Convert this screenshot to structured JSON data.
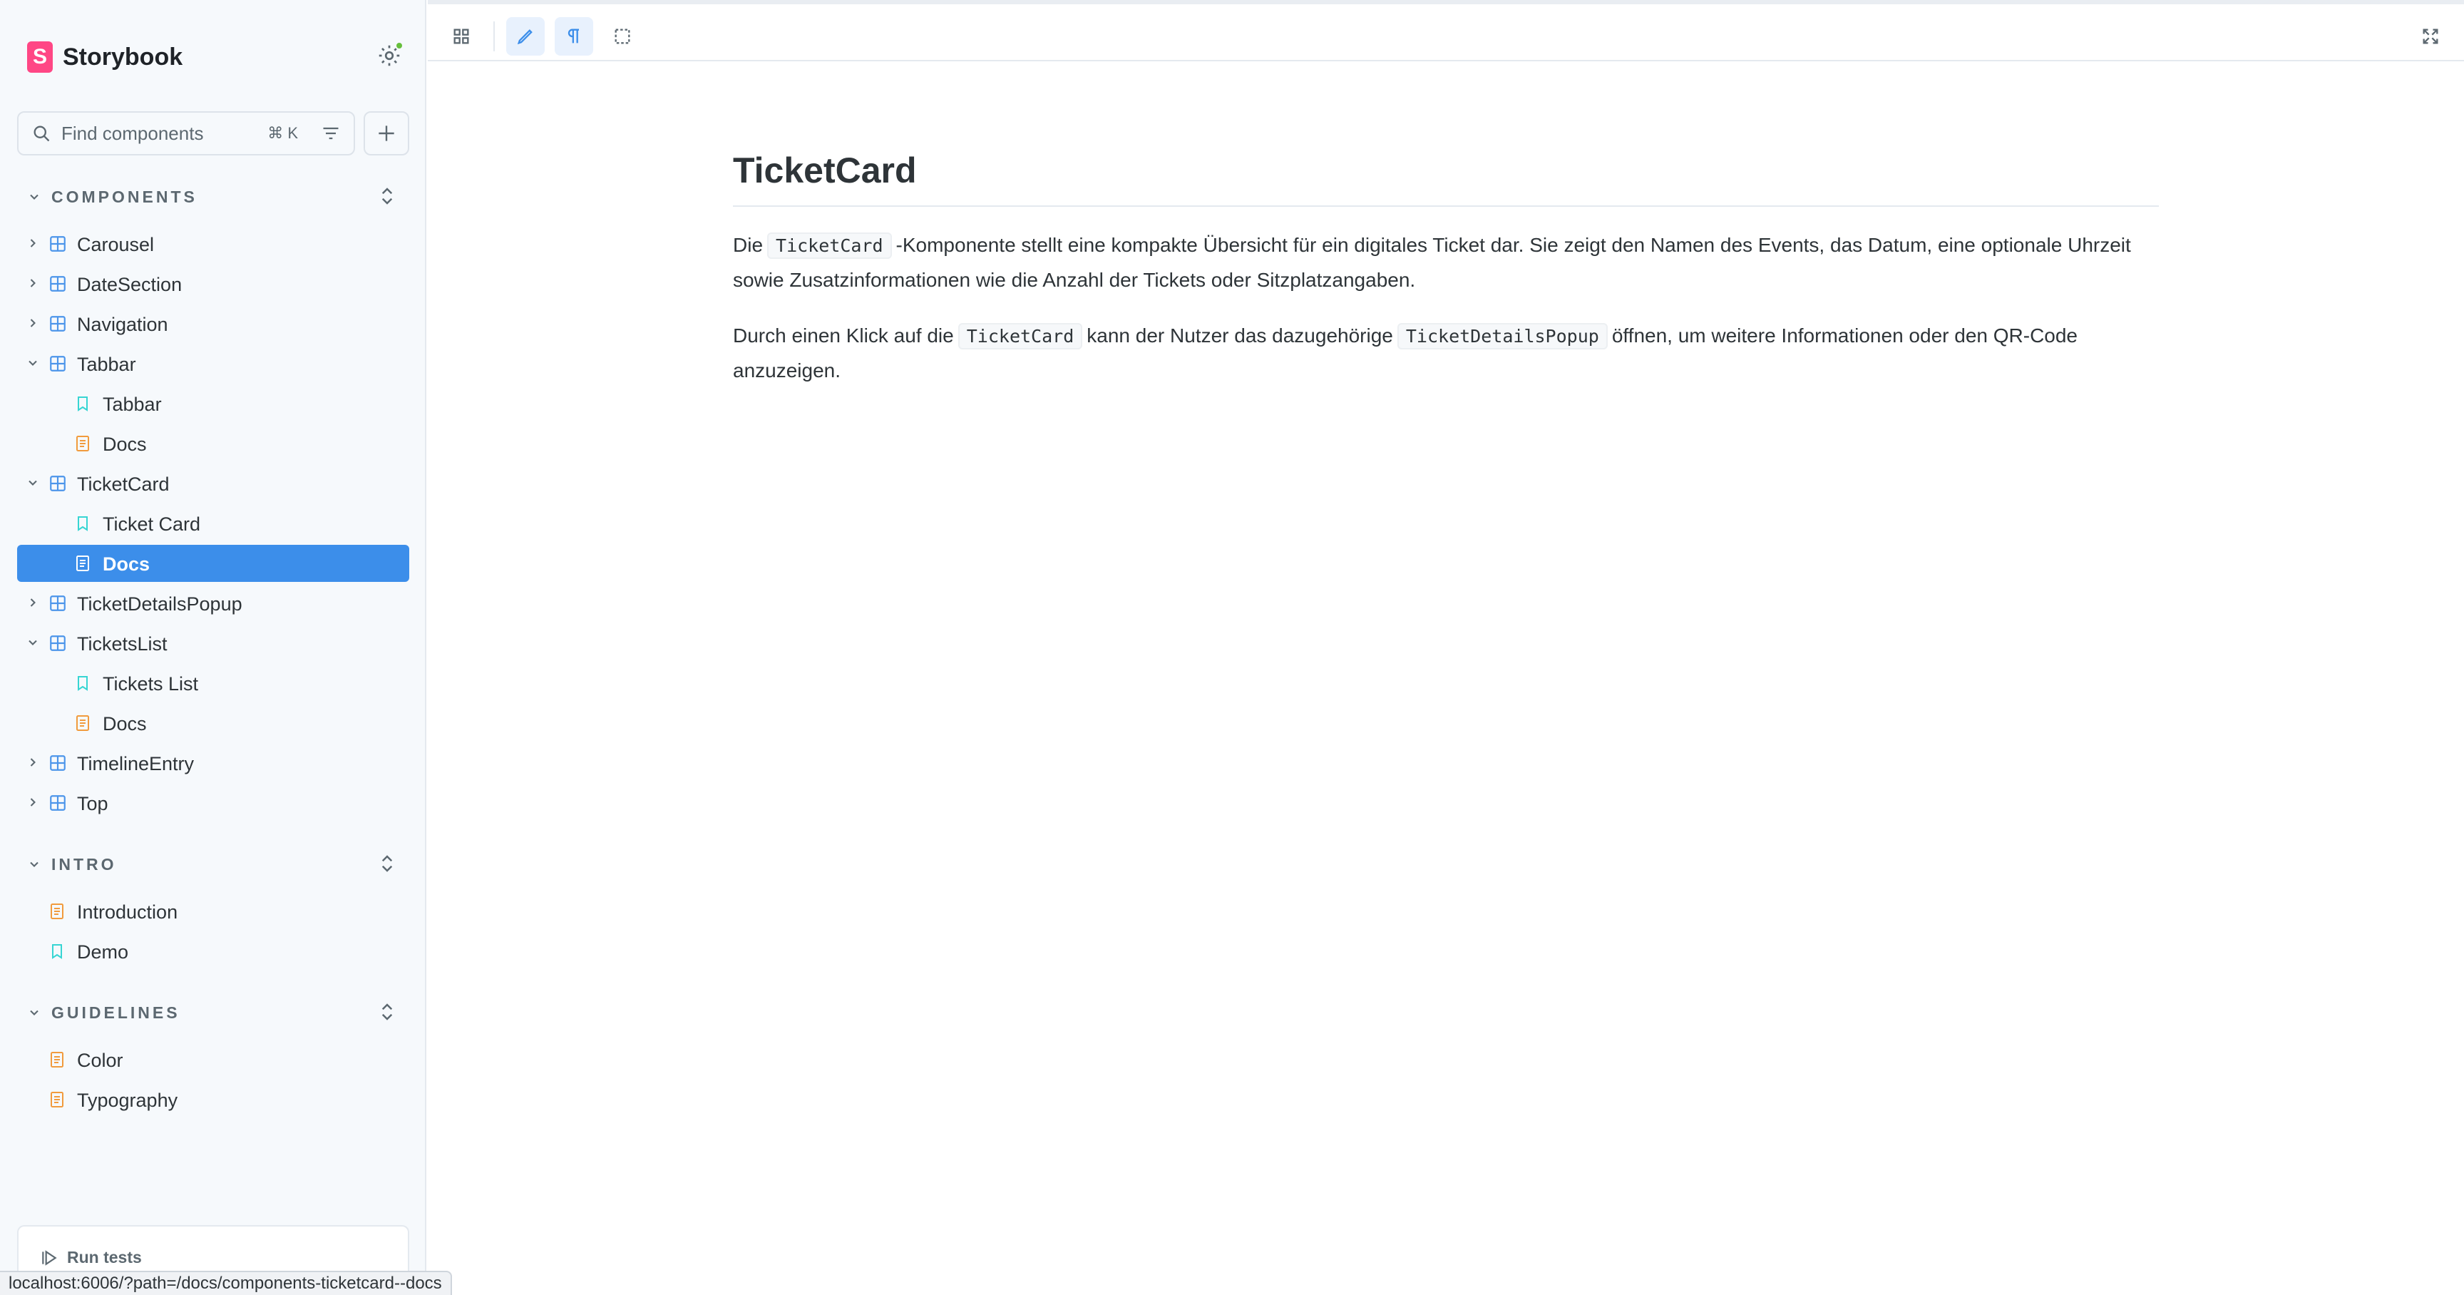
{
  "brand": {
    "name": "Storybook",
    "logo_letter": "S"
  },
  "search": {
    "placeholder": "Find components",
    "shortcut": "⌘ K"
  },
  "sections": {
    "components": "COMPONENTS",
    "intro": "INTRO",
    "guidelines": "GUIDELINES"
  },
  "tree": {
    "carousel": "Carousel",
    "datesection": "DateSection",
    "navigation": "Navigation",
    "tabbar": "Tabbar",
    "tabbar_story": "Tabbar",
    "tabbar_docs": "Docs",
    "ticketcard": "TicketCard",
    "ticketcard_story": "Ticket Card",
    "ticketcard_docs": "Docs",
    "ticketdetailspopup": "TicketDetailsPopup",
    "ticketslist": "TicketsList",
    "ticketslist_story": "Tickets List",
    "ticketslist_docs": "Docs",
    "timelineentry": "TimelineEntry",
    "top": "Top",
    "introduction": "Introduction",
    "demo": "Demo",
    "color": "Color",
    "typography": "Typography"
  },
  "footer": {
    "run_tests": "Run tests"
  },
  "status_url": "localhost:6006/?path=/docs/components-ticketcard--docs",
  "doc": {
    "title": "TicketCard",
    "p1_before": "Die",
    "p1_code": "TicketCard",
    "p1_after": "-Komponente stellt eine kompakte Übersicht für ein digitales Ticket dar. Sie zeigt den Namen des Events, das Datum, eine optionale Uhrzeit sowie Zusatzinformationen wie die Anzahl der Tickets oder Sitzplatzangaben.",
    "p2_a": "Durch einen Klick auf die",
    "p2_code1": "TicketCard",
    "p2_b": "kann der Nutzer das dazugehörige",
    "p2_code2": "TicketDetailsPopup",
    "p2_c": "öffnen, um weitere Informationen oder den QR-Code anzuzeigen."
  },
  "colors": {
    "accent": "#3c8eea",
    "brand": "#ff4785",
    "component_icon": "#4c95ea",
    "story_icon": "#37d5d3",
    "docs_icon": "#f19b3d"
  }
}
